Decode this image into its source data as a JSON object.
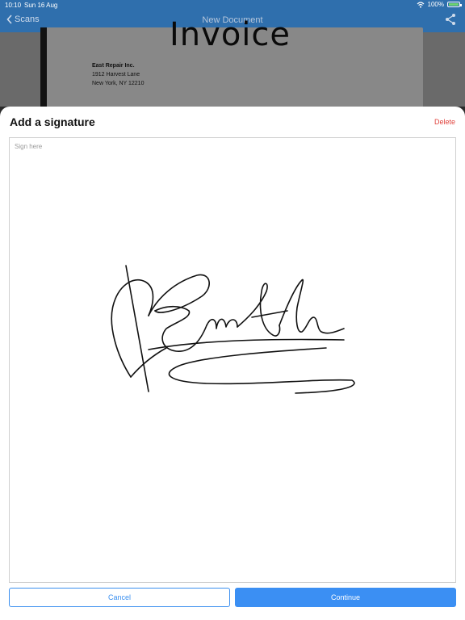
{
  "status_bar": {
    "time": "10:10",
    "date": "Sun 16 Aug",
    "battery_percent": "100%"
  },
  "nav": {
    "back_label": "Scans",
    "title": "New Document"
  },
  "background_document": {
    "heading": "Invoice",
    "company": "East Repair Inc.",
    "address_line1": "1912 Harvest Lane",
    "address_line2": "New York, NY 12210"
  },
  "signature_sheet": {
    "title": "Add a signature",
    "delete_label": "Delete",
    "placeholder": "Sign here",
    "cancel_label": "Cancel",
    "continue_label": "Continue"
  },
  "colors": {
    "nav_blue": "#2f6fad",
    "accent_blue": "#3b8ff3",
    "delete_red": "#e0433d"
  }
}
